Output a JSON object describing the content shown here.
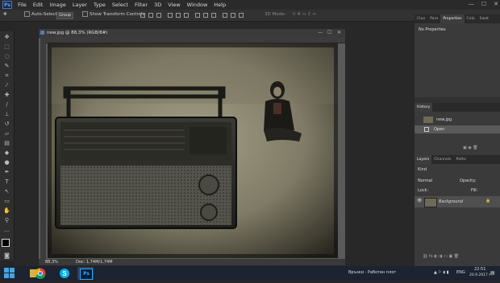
{
  "app": {
    "logo_text": "Ps"
  },
  "menu": [
    "File",
    "Edit",
    "Image",
    "Layer",
    "Type",
    "Select",
    "Filter",
    "3D",
    "View",
    "Window",
    "Help"
  ],
  "window_controls": {
    "minimize": "—",
    "maximize": "☐",
    "close": "✕"
  },
  "options_bar": {
    "auto_select_label": "Auto-Select:",
    "auto_select_value": "Group",
    "transform_label": "Show Transform Controls",
    "mode_3d": "3D Mode:"
  },
  "document": {
    "tab_title": "new.jpg @ 88,3% (RGB/8#)",
    "zoom": "88,3%",
    "doc_info": "Doc: 1,74M/1,74M"
  },
  "properties_panel": {
    "tabs": [
      "Clue",
      "Para",
      "Properties",
      "Cola",
      "Swat"
    ],
    "active_tab": "Properties",
    "empty_text": "No Properties"
  },
  "history_panel": {
    "title": "History",
    "snapshot": "new.jpg",
    "items": [
      "Open"
    ]
  },
  "layers_panel": {
    "tabs": [
      "Layers",
      "Channels",
      "Paths"
    ],
    "active_tab": "Layers",
    "kind_label": "Kind",
    "blend_mode": "Normal",
    "opacity_label": "Opacity:",
    "lock_label": "Lock:",
    "fill_label": "Fill:",
    "layers": [
      {
        "name": "Background",
        "locked": true,
        "visible": true
      }
    ]
  },
  "taskbar": {
    "lang": "ENG",
    "tray_text": "Връзки · Работен плот",
    "time": "22:51",
    "date": "20.9.2017 г."
  },
  "colors": {
    "panel_bg": "#313131",
    "accent_blue": "#4b78c6",
    "taskbar_bg": "#1c2331"
  }
}
